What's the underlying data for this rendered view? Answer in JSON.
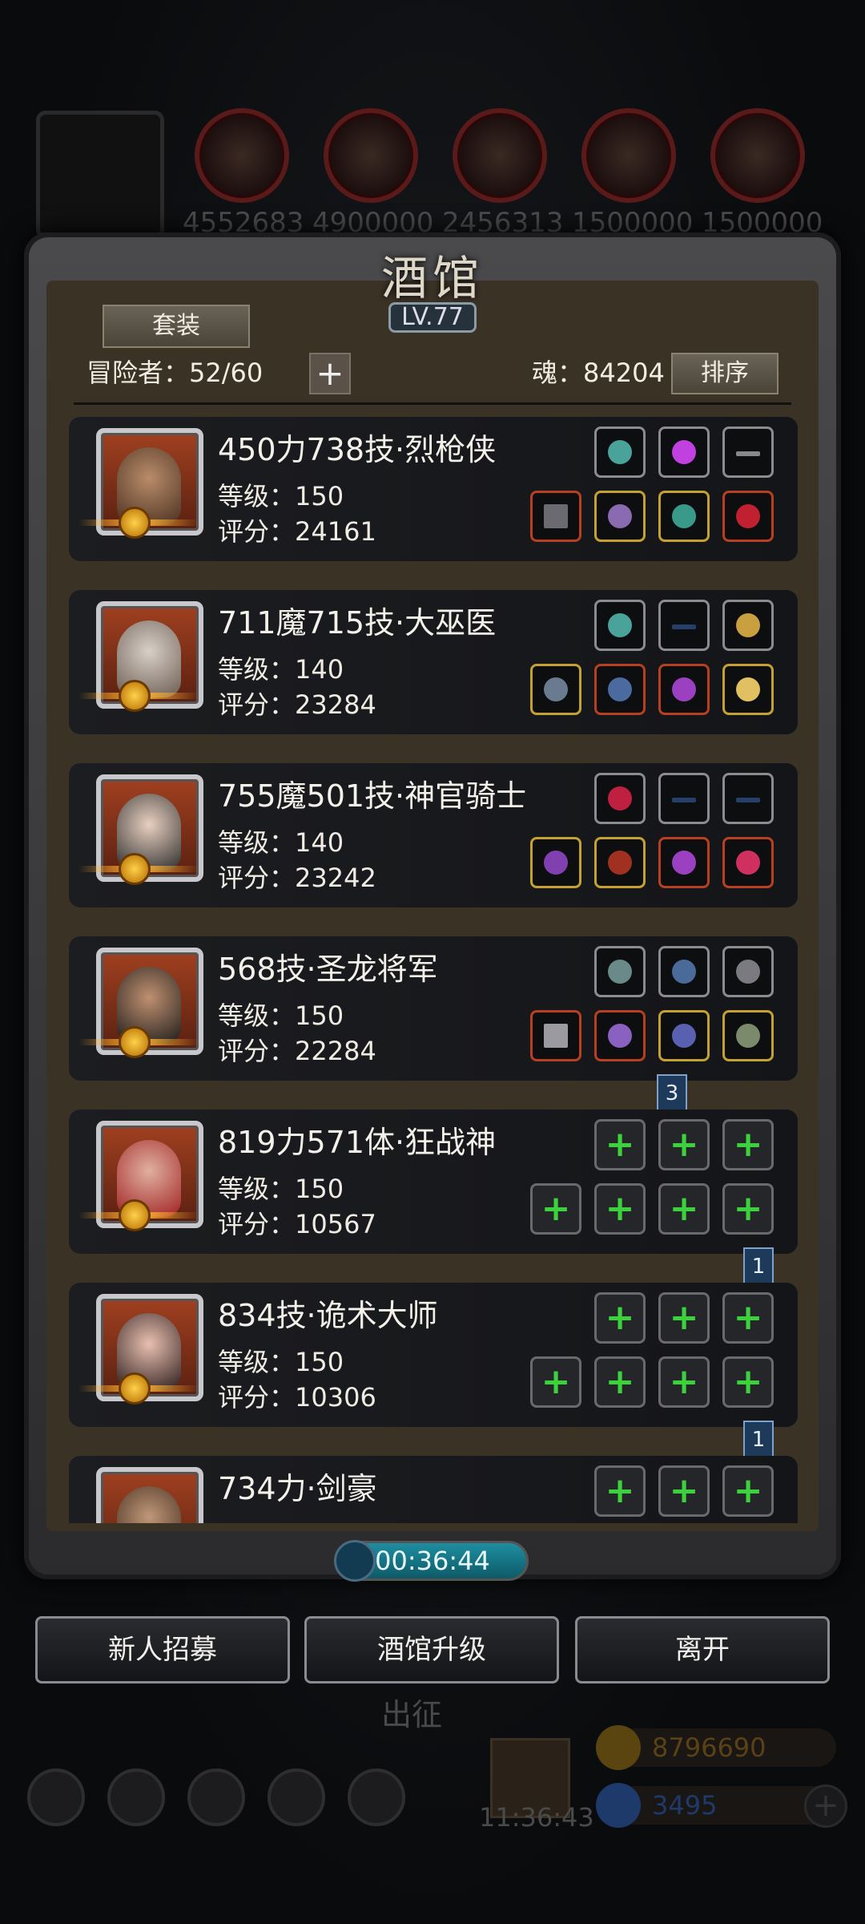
{
  "resources": {
    "values": [
      "4552683",
      "4900000",
      "2456313",
      "1500000",
      "1500000"
    ]
  },
  "header": {
    "title": "酒馆",
    "level": "LV.77",
    "suit_label": "套装",
    "adventurers_label": "冒险者：52/60",
    "soul_label": "魂：84204",
    "sort_label": "排序",
    "add_symbol": "+"
  },
  "heroes": [
    {
      "name": "450力738技·烈枪侠",
      "level": "等级：150",
      "score": "评分：24161",
      "ribbon": ""
    },
    {
      "name": "711魔715技·大巫医",
      "level": "等级：140",
      "score": "评分：23284",
      "ribbon": ""
    },
    {
      "name": "755魔501技·神官骑士",
      "level": "等级：140",
      "score": "评分：23242",
      "ribbon": ""
    },
    {
      "name": "568技·圣龙将军",
      "level": "等级：150",
      "score": "评分：22284",
      "ribbon": "3"
    },
    {
      "name": "819力571体·狂战神",
      "level": "等级：150",
      "score": "评分：10567",
      "ribbon": "1"
    },
    {
      "name": "834技·诡术大师",
      "level": "等级：150",
      "score": "评分：10306",
      "ribbon": "1"
    },
    {
      "name": "734力·剑豪",
      "level": "",
      "score": "",
      "ribbon": ""
    }
  ],
  "timer": "00:36:44",
  "buttons": {
    "recruit": "新人招募",
    "upgrade": "酒馆升级",
    "leave": "离开"
  },
  "background": {
    "expedition": "出征",
    "clock": "11:36:43",
    "gold": "8796690",
    "gems": "3495"
  },
  "colors": {
    "green_plus": "#3cd23c",
    "timer_teal": "#1e8ea0",
    "gold_frame": "#c4a130"
  }
}
